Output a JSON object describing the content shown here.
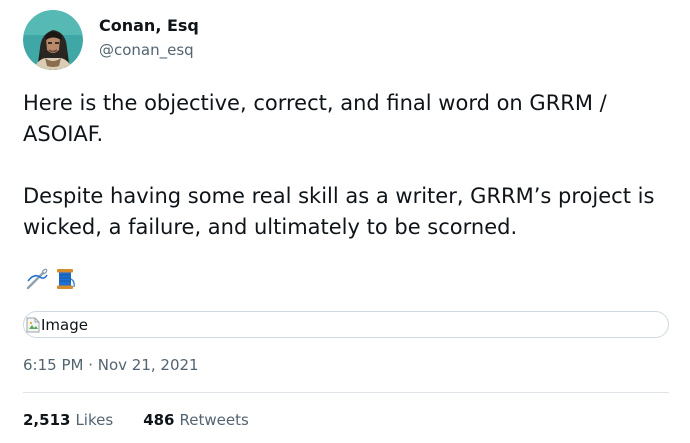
{
  "author": {
    "display_name": "Conan, Esq",
    "handle": "@conan_esq",
    "avatar_icon": "conan-portrait-icon"
  },
  "tweet": {
    "paragraphs": [
      "Here is the objective, correct, and final word on GRRM / ASOIAF.",
      "Despite having some real skill as a writer, GRRM’s project is wicked, a failure, and ultimately to be scorned."
    ],
    "emojis": [
      "needle-icon",
      "spool-of-thread-icon"
    ]
  },
  "media": {
    "alt_text": "Image"
  },
  "timestamp": "6:15 PM · Nov 21, 2021",
  "stats": {
    "likes_count": "2,513",
    "likes_label": "Likes",
    "retweets_count": "486",
    "retweets_label": "Retweets"
  },
  "colors": {
    "text_primary": "#0f1419",
    "text_secondary": "#536471",
    "border": "#cfd9de"
  }
}
